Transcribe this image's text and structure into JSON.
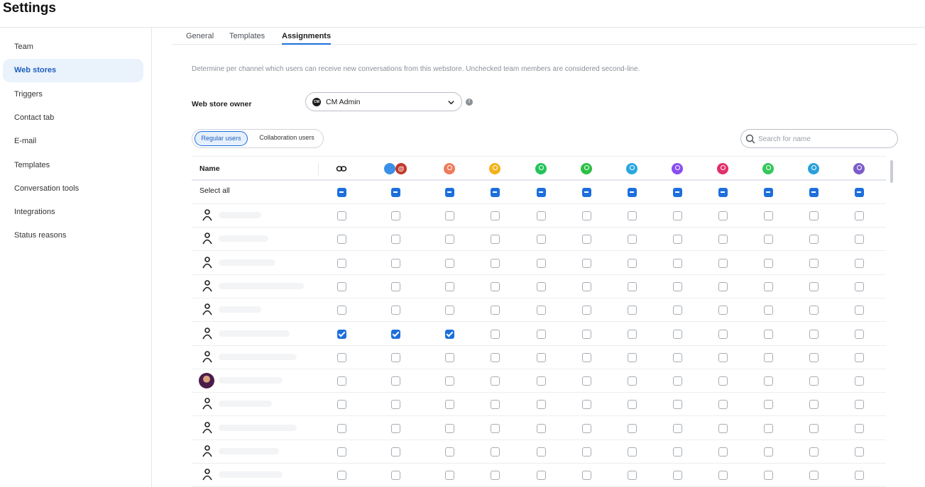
{
  "app": {
    "title": "Settings"
  },
  "sidebar": {
    "items": [
      {
        "label": "Team",
        "active": false
      },
      {
        "label": "Web stores",
        "active": true
      },
      {
        "label": "Triggers",
        "active": false
      },
      {
        "label": "Contact tab",
        "active": false
      },
      {
        "label": "E-mail",
        "active": false
      },
      {
        "label": "Templates",
        "active": false
      },
      {
        "label": "Conversation tools",
        "active": false
      },
      {
        "label": "Integrations",
        "active": false
      },
      {
        "label": "Status reasons",
        "active": false
      }
    ]
  },
  "tabs": [
    {
      "label": "General",
      "active": false
    },
    {
      "label": "Templates",
      "active": false
    },
    {
      "label": "Assignments",
      "active": true
    }
  ],
  "description": "Determine per channel which users can receive new conversations from this webstore. Unchecked team members are considered second-line.",
  "owner": {
    "label": "Web store owner",
    "value": "CM Admin",
    "badge": "CM"
  },
  "user_toggle": {
    "options": [
      "Regular users",
      "Collaboration users"
    ],
    "selected": "Regular users"
  },
  "search": {
    "placeholder": "Search for name"
  },
  "table": {
    "name_header": "Name",
    "select_all_label": "Select all",
    "channels": [
      {
        "name": "link-icon",
        "color": "#1d1d1f"
      },
      {
        "name": "email-channels-icon",
        "color": "#3b8fe6"
      },
      {
        "name": "webchat-icon",
        "color": "#ef7a5a"
      },
      {
        "name": "voice-icon",
        "color": "#f2b21b"
      },
      {
        "name": "whatsapp-icon",
        "color": "#25c35a"
      },
      {
        "name": "sms-icon",
        "color": "#2dbf46"
      },
      {
        "name": "livechat-icon",
        "color": "#2aa7e0"
      },
      {
        "name": "messenger-icon",
        "color": "#8a4df0"
      },
      {
        "name": "instagram-icon",
        "color": "#e1306c"
      },
      {
        "name": "imessage-icon",
        "color": "#34c759"
      },
      {
        "name": "telegram-icon",
        "color": "#2aa1da"
      },
      {
        "name": "viber-icon",
        "color": "#7b5cc9"
      }
    ],
    "rows": [
      {
        "avatar": "default",
        "checked": [
          false,
          false,
          false,
          false,
          false,
          false,
          false,
          false,
          false,
          false,
          false,
          false
        ]
      },
      {
        "avatar": "default",
        "checked": [
          false,
          false,
          false,
          false,
          false,
          false,
          false,
          false,
          false,
          false,
          false,
          false
        ]
      },
      {
        "avatar": "default",
        "checked": [
          false,
          false,
          false,
          false,
          false,
          false,
          false,
          false,
          false,
          false,
          false,
          false
        ]
      },
      {
        "avatar": "default",
        "checked": [
          false,
          false,
          false,
          false,
          false,
          false,
          false,
          false,
          false,
          false,
          false,
          false
        ]
      },
      {
        "avatar": "default",
        "checked": [
          false,
          false,
          false,
          false,
          false,
          false,
          false,
          false,
          false,
          false,
          false,
          false
        ]
      },
      {
        "avatar": "default",
        "checked": [
          true,
          true,
          true,
          false,
          false,
          false,
          false,
          false,
          false,
          false,
          false,
          false
        ]
      },
      {
        "avatar": "default",
        "checked": [
          false,
          false,
          false,
          false,
          false,
          false,
          false,
          false,
          false,
          false,
          false,
          false
        ]
      },
      {
        "avatar": "photo",
        "checked": [
          false,
          false,
          false,
          false,
          false,
          false,
          false,
          false,
          false,
          false,
          false,
          false
        ]
      },
      {
        "avatar": "default",
        "checked": [
          false,
          false,
          false,
          false,
          false,
          false,
          false,
          false,
          false,
          false,
          false,
          false
        ]
      },
      {
        "avatar": "default",
        "checked": [
          false,
          false,
          false,
          false,
          false,
          false,
          false,
          false,
          false,
          false,
          false,
          false
        ]
      },
      {
        "avatar": "default",
        "checked": [
          false,
          false,
          false,
          false,
          false,
          false,
          false,
          false,
          false,
          false,
          false,
          false
        ]
      },
      {
        "avatar": "default",
        "checked": [
          false,
          false,
          false,
          false,
          false,
          false,
          false,
          false,
          false,
          false,
          false,
          false
        ]
      }
    ]
  }
}
